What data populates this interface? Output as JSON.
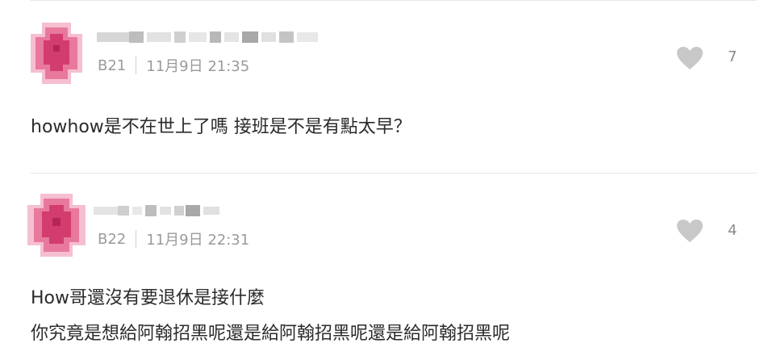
{
  "comments": [
    {
      "floor": "B21",
      "timestamp": "11月9日 21:35",
      "likes": "7",
      "lines": [
        "howhow是不在世上了嗎 接班是不是有點太早？"
      ]
    },
    {
      "floor": "B22",
      "timestamp": "11月9日 22:31",
      "likes": "4",
      "lines": [
        "How哥還沒有要退休是接什麼",
        "你究竟是想給阿翰招黑呢還是給阿翰招黑呢還是給阿翰招黑呢"
      ]
    }
  ],
  "icons": {
    "like": "heart-icon",
    "avatar": "pixelated-avatar"
  },
  "colors": {
    "heart": "#c8c8c8",
    "avatar_core": "#d23c6e",
    "avatar_mid": "#e8799c",
    "avatar_light": "#f6bfd1",
    "meta_text": "#9a9a9a"
  }
}
